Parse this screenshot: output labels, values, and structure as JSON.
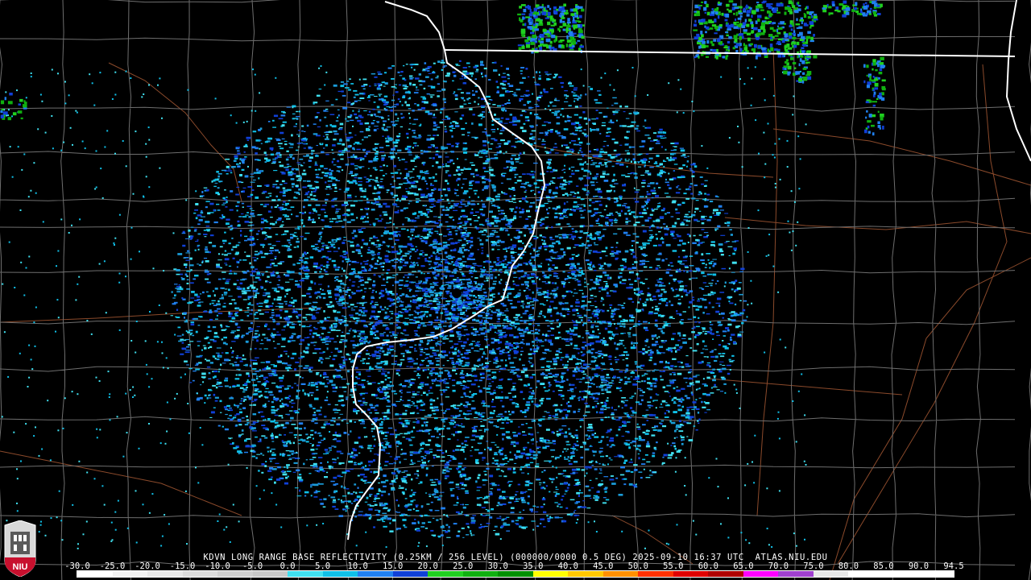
{
  "caption": "KDVN LONG RANGE BASE REFLECTIVITY (0.25KM / 256 LEVEL) (000000/0000 0.5 DEG) 2025-09-10 16:37 UTC  ATLAS.NIU.EDU",
  "logo": {
    "text": "NIU",
    "icon": "niu-tower-logo-icon",
    "colors": {
      "top": "#d9d9d9",
      "bottom": "#c8102e"
    }
  },
  "legend": {
    "labels": [
      "-30.0",
      "-25.0",
      "-20.0",
      "-15.0",
      "-10.0",
      "-5.0",
      "0.0",
      "5.0",
      "10.0",
      "15.0",
      "20.0",
      "25.0",
      "30.0",
      "35.0",
      "40.0",
      "45.0",
      "50.0",
      "55.0",
      "60.0",
      "65.0",
      "70.0",
      "75.0",
      "80.0",
      "85.0",
      "90.0",
      "94.5"
    ],
    "colors": [
      "#ffffff",
      "#f2f2f2",
      "#e8e8e8",
      "#dcdcdc",
      "#d0d0d0",
      "#c8c8c8",
      "#40e0f0",
      "#10c0e8",
      "#2080f0",
      "#1040d8",
      "#20d020",
      "#10b010",
      "#009000",
      "#ffff00",
      "#ffc800",
      "#ff9000",
      "#ff3000",
      "#e00000",
      "#b00000",
      "#ff00ff",
      "#a040d0",
      "#e8e8e8",
      "#ffffff",
      "#ffffff",
      "#ffffff"
    ]
  },
  "map": {
    "radar_site": "KDVN",
    "colors": {
      "county_lines": "#6e6e6e",
      "state_lines": "#ffffff",
      "roads": "#8b4a2b",
      "background": "#000000"
    },
    "echo_palette": [
      "#40e0f0",
      "#10c0e8",
      "#2080f0",
      "#1040d8",
      "#1a9cd8"
    ],
    "storm_palette": [
      "#1040d8",
      "#2080f0",
      "#20d020",
      "#10b010"
    ]
  }
}
